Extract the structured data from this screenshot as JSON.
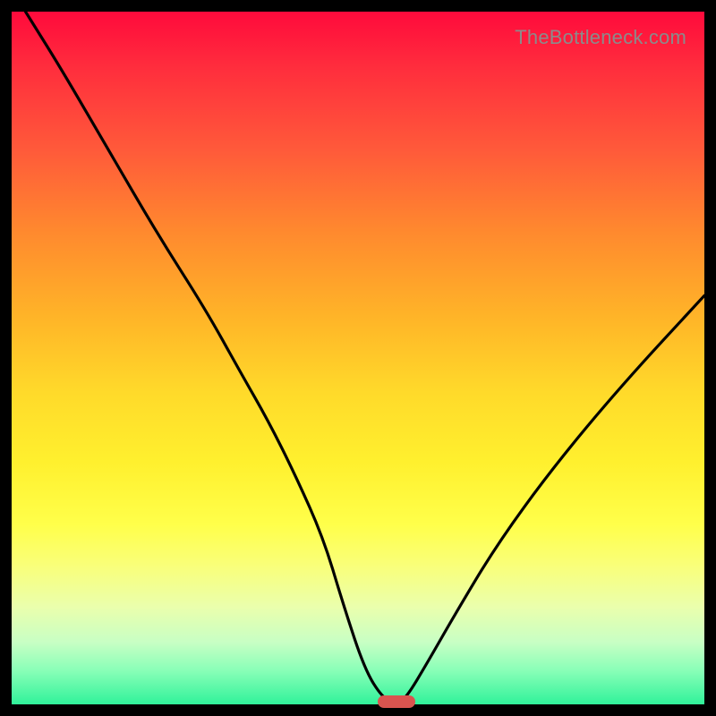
{
  "attribution": "TheBottleneck.com",
  "colors": {
    "frame": "#000000",
    "curve": "#000000",
    "pill": "#d9544f",
    "attribution_text": "#8b8b8b"
  },
  "chart_data": {
    "type": "line",
    "title": "",
    "xlabel": "",
    "ylabel": "",
    "xlim": [
      0,
      100
    ],
    "ylim": [
      0,
      100
    ],
    "grid": false,
    "legend": false,
    "annotations": [
      {
        "text": "TheBottleneck.com",
        "x": 100,
        "y": 100,
        "align": "right-top"
      }
    ],
    "series": [
      {
        "name": "bottleneck-curve",
        "x": [
          2,
          7,
          14,
          21,
          28,
          33,
          37,
          41,
          45,
          48,
          51,
          53.5,
          55.5,
          57,
          60,
          64,
          70,
          78,
          88,
          100
        ],
        "y": [
          100,
          92,
          80,
          68,
          57,
          48,
          41,
          33,
          24,
          14,
          5,
          1,
          0,
          1,
          6,
          13,
          23,
          34,
          46,
          59
        ]
      }
    ],
    "marker": {
      "x": 55.5,
      "y": 0,
      "shape": "pill",
      "color": "#d9544f"
    }
  }
}
